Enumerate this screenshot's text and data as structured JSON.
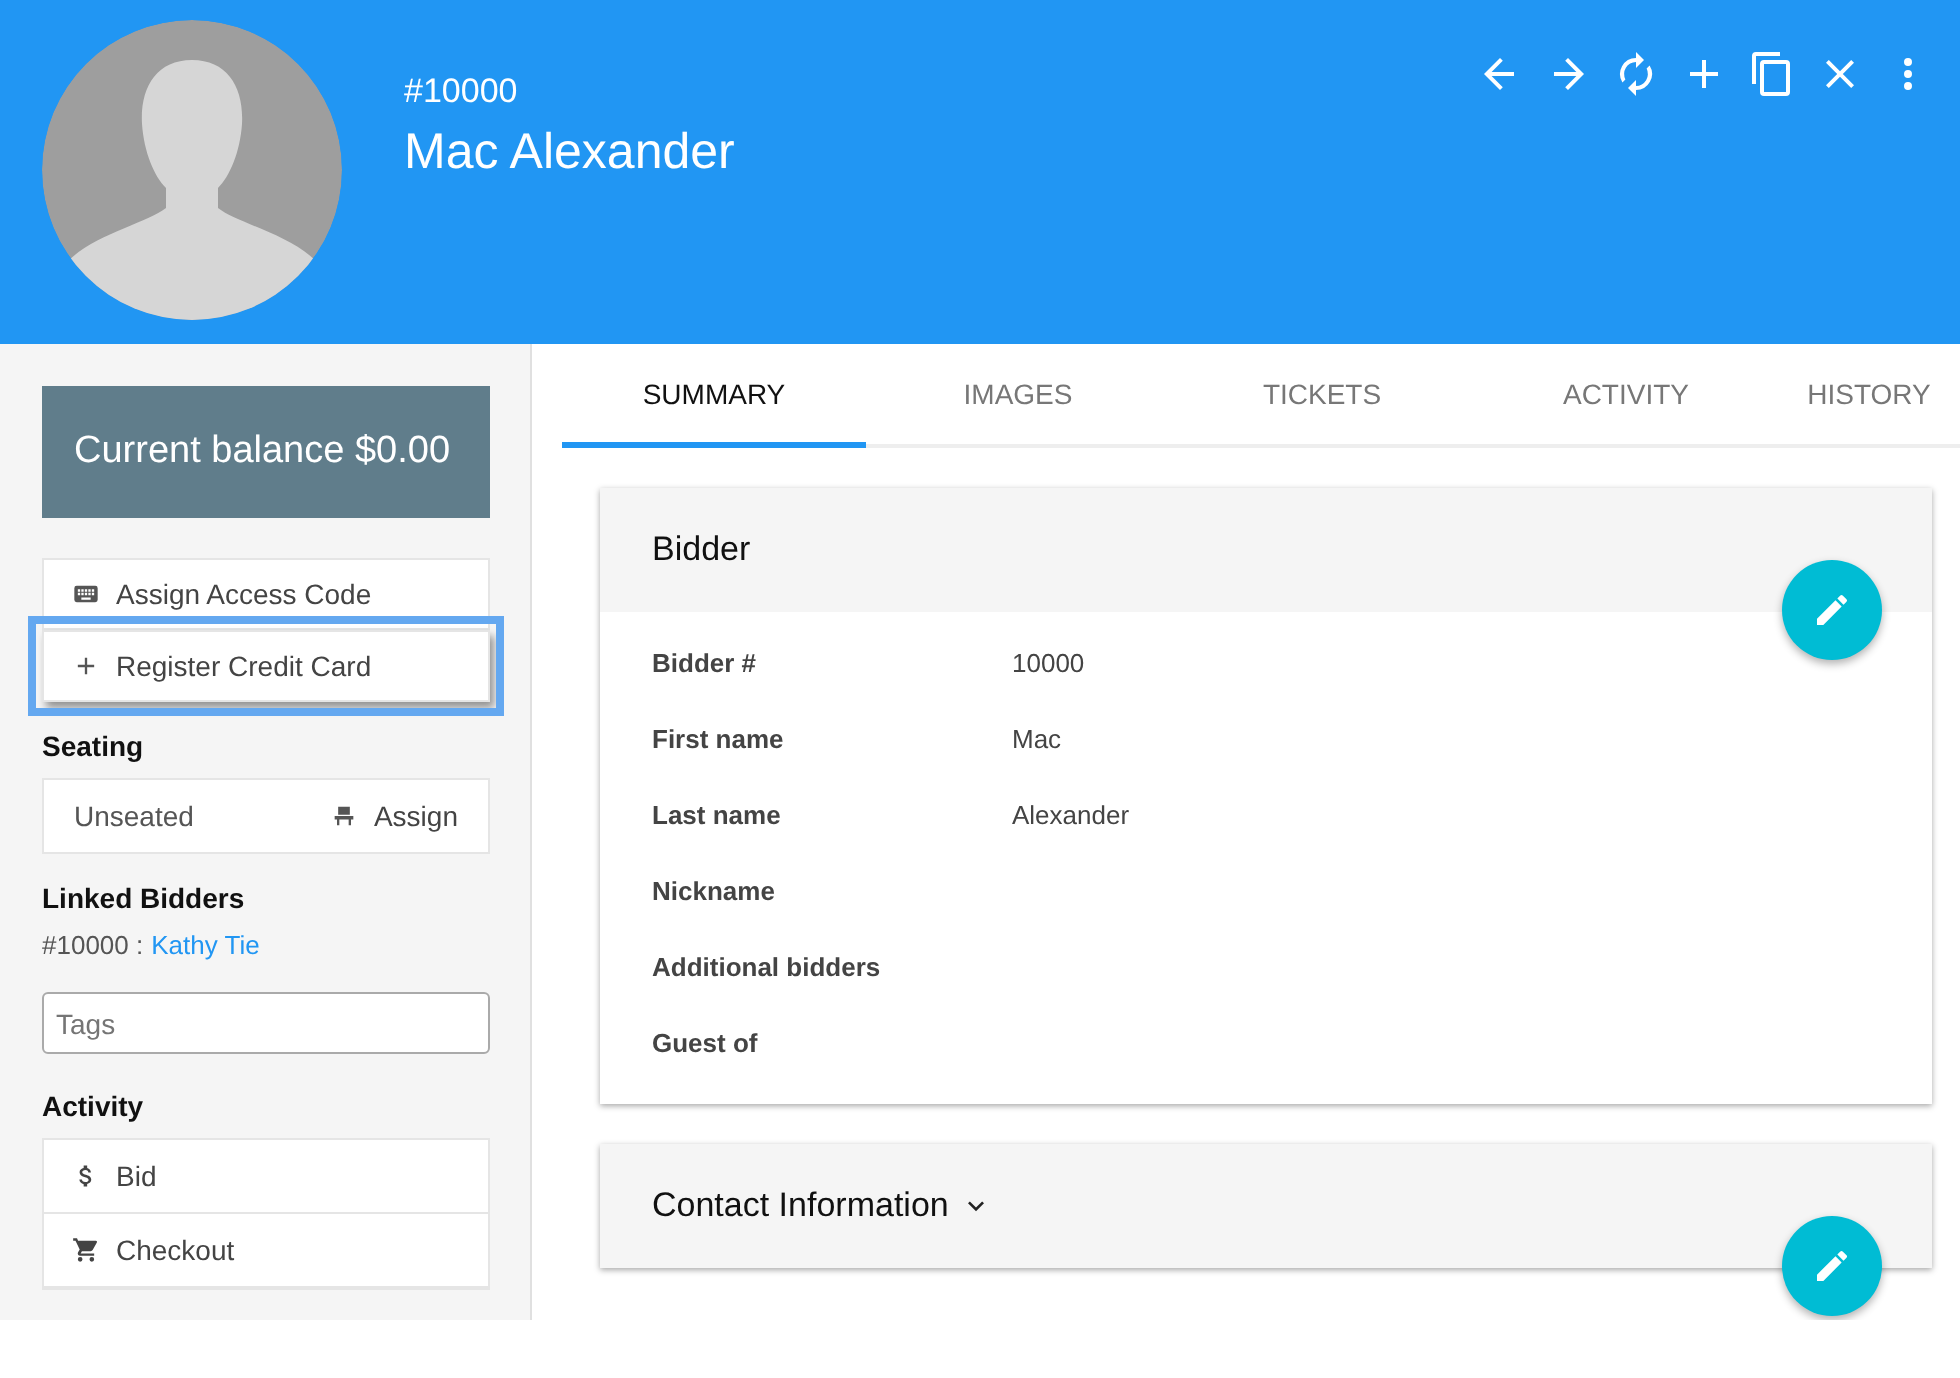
{
  "header": {
    "number": "#10000",
    "name": "Mac Alexander",
    "toolbar": [
      {
        "kind": "back"
      },
      {
        "kind": "forward"
      },
      {
        "kind": "refresh"
      },
      {
        "kind": "add"
      },
      {
        "kind": "copy"
      },
      {
        "kind": "close"
      },
      {
        "kind": "more"
      }
    ]
  },
  "sidebar": {
    "balance": "Current balance $0.00",
    "actions": [
      {
        "kind": "keyboard",
        "label": "Assign Access Code",
        "focused": false
      },
      {
        "kind": "plus",
        "label": "Register Credit Card",
        "focused": true
      }
    ],
    "seating": {
      "title": "Seating",
      "status": "Unseated",
      "action": "Assign"
    },
    "linked": {
      "title": "Linked Bidders",
      "number": "#10000 :",
      "name": "Kathy Tie"
    },
    "tags": {
      "placeholder": "Tags"
    },
    "activity": {
      "title": "Activity",
      "items": [
        {
          "kind": "dollar",
          "label": "Bid"
        },
        {
          "kind": "cart",
          "label": "Checkout"
        }
      ]
    }
  },
  "tabs": [
    {
      "label": "SUMMARY",
      "selected": true
    },
    {
      "label": "IMAGES",
      "selected": false
    },
    {
      "label": "TICKETS",
      "selected": false
    },
    {
      "label": "ACTIVITY",
      "selected": false
    },
    {
      "label": "HISTORY",
      "selected": false
    }
  ],
  "cards": [
    {
      "title": "Bidder",
      "dropdown": false,
      "fields": [
        {
          "label": "Bidder #",
          "value": "10000"
        },
        {
          "label": "First name",
          "value": "Mac"
        },
        {
          "label": "Last name",
          "value": "Alexander"
        },
        {
          "label": "Nickname"
        },
        {
          "label": "Additional bidders"
        },
        {
          "label": "Guest of"
        }
      ]
    },
    {
      "title": "Contact Information",
      "dropdown": true
    }
  ]
}
